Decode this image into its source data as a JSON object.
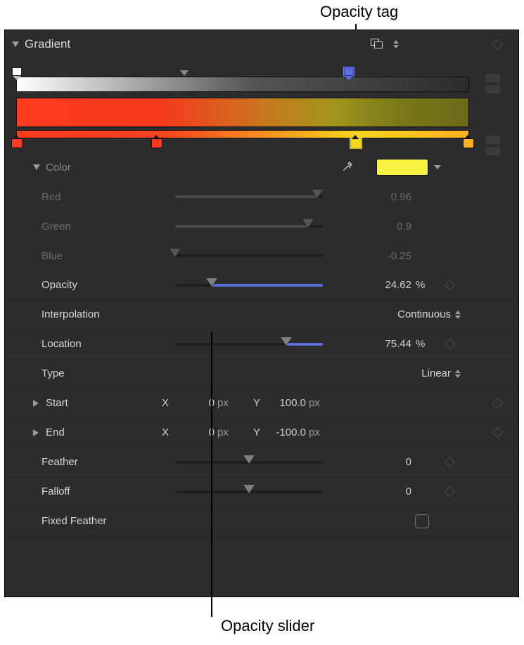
{
  "annotations": {
    "opacity_tag": "Opacity tag",
    "opacity_slider": "Opacity slider"
  },
  "panel": {
    "title": "Gradient",
    "color_section": "Color",
    "color_swatch": "#f7f342",
    "red": {
      "label": "Red",
      "value": "0.96"
    },
    "green": {
      "label": "Green",
      "value": "0.9"
    },
    "blue": {
      "label": "Blue",
      "value": "-0.25"
    },
    "opacity": {
      "label": "Opacity",
      "value": "24.62",
      "unit": "%"
    },
    "interpolation": {
      "label": "Interpolation",
      "value": "Continuous"
    },
    "location": {
      "label": "Location",
      "value": "75.44",
      "unit": "%"
    },
    "type": {
      "label": "Type",
      "value": "Linear"
    },
    "start": {
      "label": "Start",
      "x_label": "X",
      "x": "0",
      "x_unit": "px",
      "y_label": "Y",
      "y": "100.0",
      "y_unit": "px"
    },
    "end": {
      "label": "End",
      "x_label": "X",
      "x": "0",
      "x_unit": "px",
      "y_label": "Y",
      "y": "-100.0",
      "y_unit": "px"
    },
    "feather": {
      "label": "Feather",
      "value": "0"
    },
    "falloff": {
      "label": "Falloff",
      "value": "0"
    },
    "fixed_feather": {
      "label": "Fixed Feather"
    }
  }
}
